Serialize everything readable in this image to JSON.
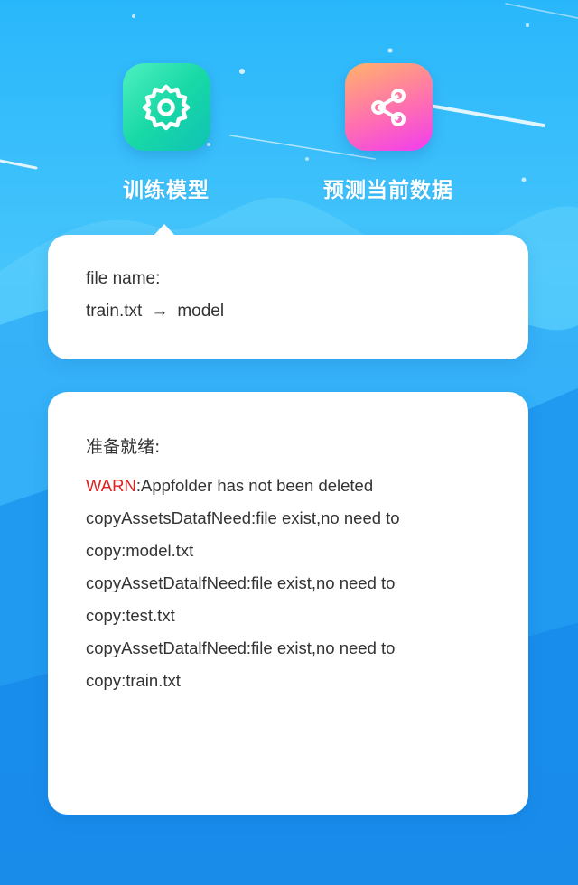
{
  "actions": {
    "train": {
      "label": "训练模型",
      "icon": "gear-icon",
      "color": "#1ed8ab"
    },
    "predict": {
      "label": "预测当前数据",
      "icon": "share-icon",
      "color": "#ff5fc8"
    }
  },
  "file_card": {
    "label": "file name:",
    "source": "train.txt",
    "arrow": "→",
    "target": "model"
  },
  "status_card": {
    "title": "准备就绪:",
    "warn_tag": "WARN",
    "lines": [
      ":Appfolder has not been deleted",
      "copyAssetsDatafNeed:file exist,no need to",
      "copy:model.txt",
      "copyAssetDatalfNeed:file exist,no need to",
      "copy:test.txt",
      "copyAssetDatalfNeed:file exist,no need to",
      "copy:train.txt"
    ]
  },
  "colors": {
    "background": "#1e9cf1",
    "warn": "#e01f1f",
    "text": "#333333"
  }
}
